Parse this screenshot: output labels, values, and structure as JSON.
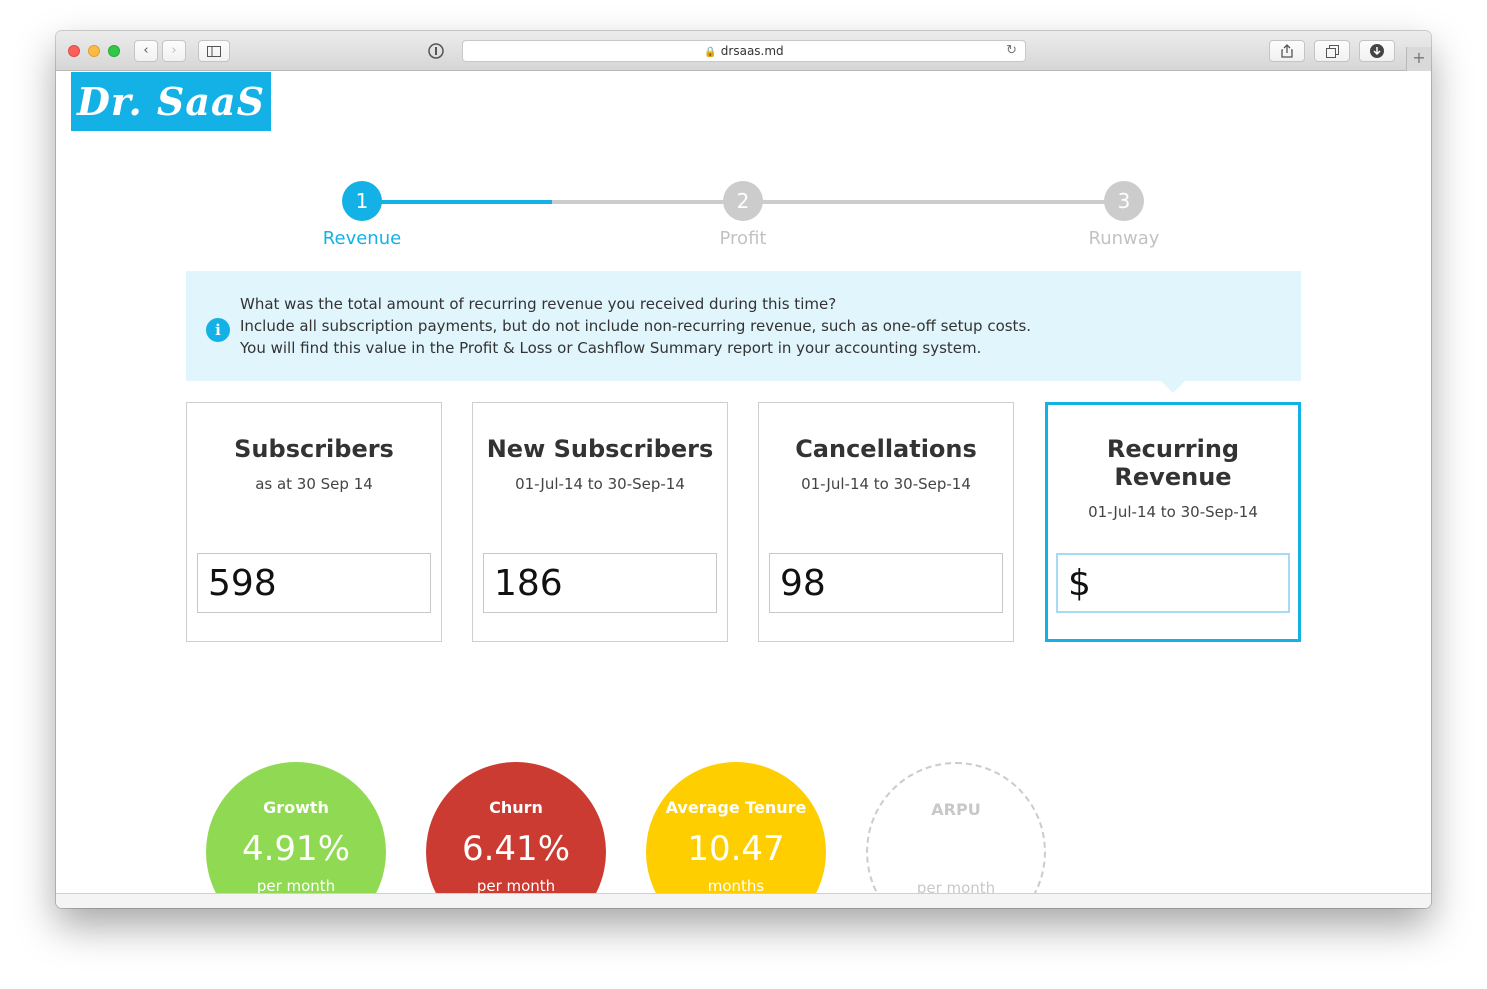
{
  "browser": {
    "url": "drsaas.md",
    "back_glyph": "‹",
    "forward_glyph": "›",
    "reload_glyph": "↻",
    "newtab_glyph": "+"
  },
  "logo": {
    "text": "Dr. SaaS",
    "color": "#14b1e7"
  },
  "steps": [
    {
      "number": "1",
      "label": "Revenue",
      "state": "active"
    },
    {
      "number": "2",
      "label": "Profit",
      "state": "idle"
    },
    {
      "number": "3",
      "label": "Runway",
      "state": "idle"
    }
  ],
  "info": {
    "icon": "i",
    "lines": [
      "What was the total amount of recurring revenue you received during this time?",
      "Include all subscription payments, but do not include non-recurring revenue, such as one-off setup costs.",
      "You will find this value in the Profit & Loss or Cashflow Summary report in your accounting system."
    ]
  },
  "cards": [
    {
      "title": "Subscribers",
      "subtitle": "as at 30 Sep 14",
      "value": "598"
    },
    {
      "title": "New Subscribers",
      "subtitle": "01-Jul-14 to 30-Sep-14",
      "value": "186"
    },
    {
      "title": "Cancellations",
      "subtitle": "01-Jul-14 to 30-Sep-14",
      "value": "98"
    },
    {
      "title": "Recurring Revenue",
      "subtitle": "01-Jul-14 to 30-Sep-14",
      "value": "$"
    }
  ],
  "metrics": [
    {
      "title": "Growth",
      "value": "4.91%",
      "unit": "per month",
      "color": "#8fda52"
    },
    {
      "title": "Churn",
      "value": "6.41%",
      "unit": "per month",
      "color": "#cc3b32"
    },
    {
      "title": "Average Tenure",
      "value": "10.47",
      "unit": "months",
      "color": "#fece00"
    },
    {
      "title": "ARPU",
      "value": "",
      "unit": "per month",
      "color": "#cccccc"
    }
  ]
}
